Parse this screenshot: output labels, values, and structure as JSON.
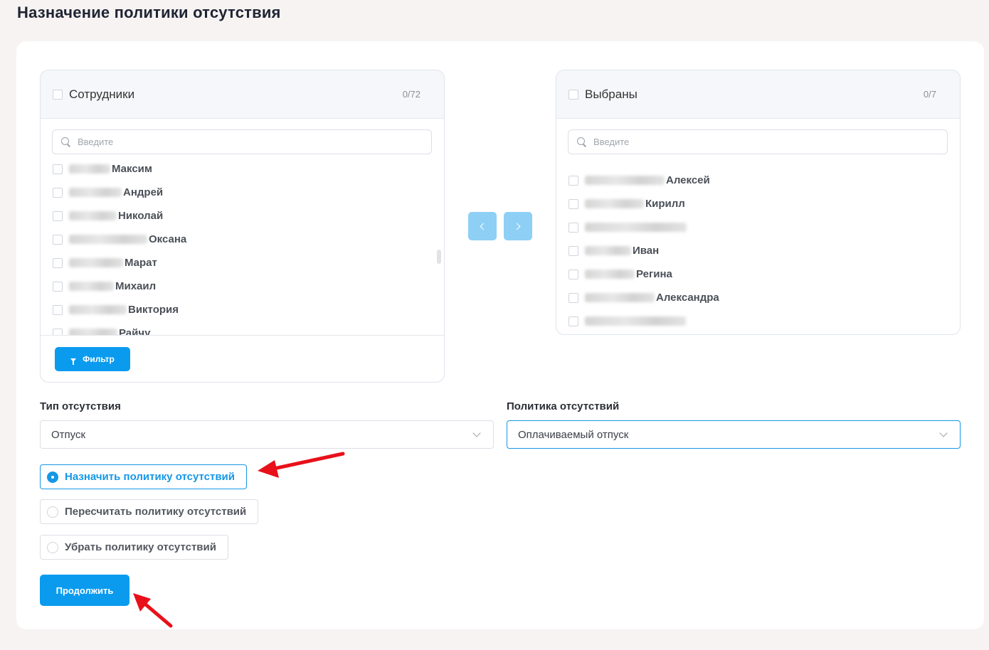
{
  "page": {
    "title": "Назначение политики отсутствия"
  },
  "transfer": {
    "left": {
      "title": "Сотрудники",
      "count": "0/72",
      "search_placeholder": "Введите",
      "items": [
        {
          "name": "Максим"
        },
        {
          "name": "Андрей"
        },
        {
          "name": "Николай"
        },
        {
          "name": "Оксана"
        },
        {
          "name": "Марат"
        },
        {
          "name": "Михаил"
        },
        {
          "name": "Виктория"
        },
        {
          "name": "Райчу"
        }
      ],
      "filter_label": "Фильтр"
    },
    "right": {
      "title": "Выбраны",
      "count": "0/7",
      "search_placeholder": "Введите",
      "items": [
        {
          "name": "Алексей"
        },
        {
          "name": "Кирилл"
        },
        {
          "name": ""
        },
        {
          "name": "Иван"
        },
        {
          "name": "Регина"
        },
        {
          "name": "Александра"
        },
        {
          "name": ""
        }
      ]
    }
  },
  "form": {
    "absence_type": {
      "label": "Тип отсутствия",
      "value": "Отпуск"
    },
    "absence_policy": {
      "label": "Политика отсутствий",
      "value": "Оплачиваемый отпуск"
    },
    "actions": [
      {
        "label": "Назначить политику отсутствий",
        "selected": true
      },
      {
        "label": "Пересчитать политику отсутствий",
        "selected": false
      },
      {
        "label": "Убрать политику отсутствий",
        "selected": false
      }
    ],
    "continue_label": "Продолжить"
  },
  "colors": {
    "accent": "#0a9bef",
    "arrow_buttons": "#8ecff5",
    "annotation": "#e8101a"
  }
}
